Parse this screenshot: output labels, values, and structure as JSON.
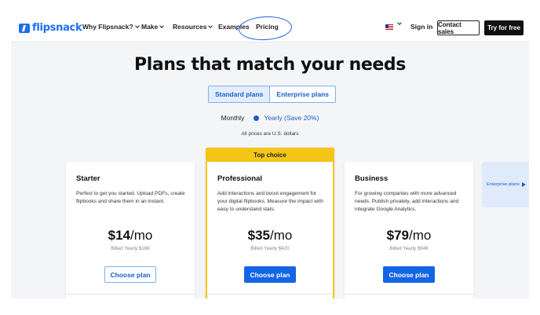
{
  "nav": {
    "logo": "flipsnack",
    "items": [
      {
        "label": "Why Flipsnack?",
        "dropdown": true
      },
      {
        "label": "Make",
        "dropdown": true
      },
      {
        "label": "Resources",
        "dropdown": true
      },
      {
        "label": "Examples",
        "dropdown": false
      },
      {
        "label": "Pricing",
        "dropdown": false
      }
    ],
    "sign_in": "Sign in",
    "contact_sales": "Contact sales",
    "try_free": "Try for free"
  },
  "headline": "Plans that match your needs",
  "plan_tabs": [
    {
      "label": "Standard plans",
      "active": true
    },
    {
      "label": "Enterprise plans",
      "active": false
    }
  ],
  "billing": {
    "monthly": "Monthly",
    "yearly": "Yearly (Save 20%)",
    "selected": "yearly",
    "note": "All prices are U.S. dollars"
  },
  "plans": [
    {
      "name": "Starter",
      "description": "Perfect to get you started. Upload PDFs, create flipbooks and share them in an instant.",
      "price": "14",
      "currency": "$",
      "period": "/mo",
      "billed": "Billed Yearly $168",
      "cta": "Choose plan",
      "badge": ""
    },
    {
      "name": "Professional",
      "description": "Add interactions and boost engagement for your digital flipbooks. Measure the impact with easy to understand stats.",
      "price": "35",
      "currency": "$",
      "period": "/mo",
      "billed": "Billed Yearly $420",
      "cta": "Choose plan",
      "badge": "Top choice"
    },
    {
      "name": "Business",
      "description": "For growing companies with more advanced needs. Publish privately, add interactions and integrate Google Analytics.",
      "price": "79",
      "currency": "$",
      "period": "/mo",
      "billed": "Billed Yearly $948",
      "cta": "Choose plan",
      "badge": ""
    }
  ],
  "side_tab": "Enterprise plans",
  "colors": {
    "brand": "#1e6ff0",
    "accent": "#1364e6",
    "highlight": "#f5c518",
    "annotation": "#1f5fd6"
  }
}
